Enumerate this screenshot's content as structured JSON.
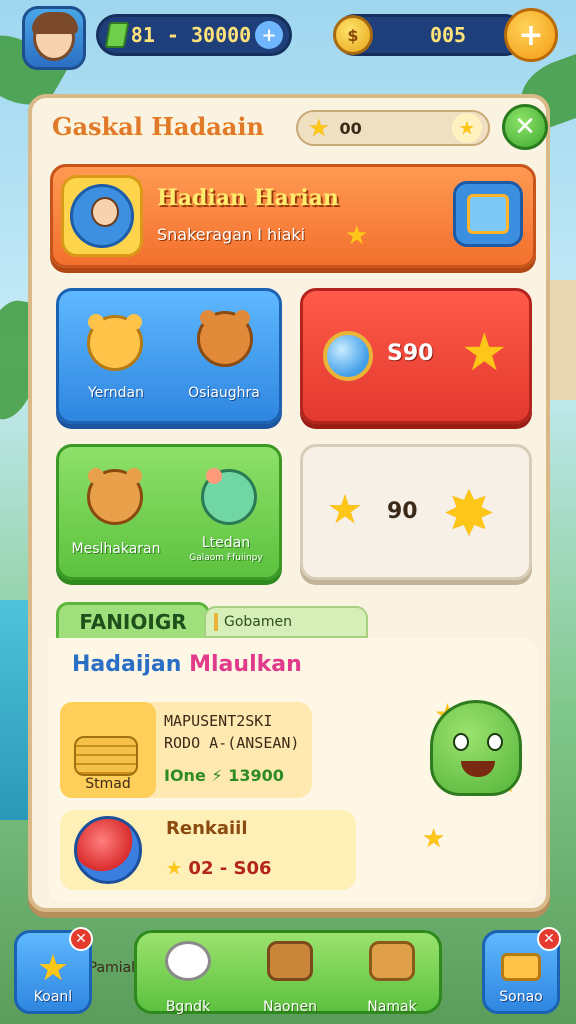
{
  "topbar": {
    "coins_value": "81 - 30000",
    "coins_plus": "+",
    "gems_value": "005",
    "gem_coin_glyph": "$",
    "add_button": "+"
  },
  "panel": {
    "title": "Gaskal Hadaain",
    "star_count": "00",
    "close_glyph": "✕",
    "daily": {
      "title": "Hadian Harian",
      "subtitle": "Snakeragan I hiaki"
    },
    "cards": {
      "blue": {
        "pet1_label": "Yerndan",
        "pet2_label": "Osiaughra"
      },
      "red": {
        "value": "S90"
      },
      "green": {
        "pet1_label": "Meslhakaran",
        "pet2_label": "Ltedan",
        "pet2_sub": "Galaom Ffuiinpy"
      },
      "white": {
        "value": "90"
      }
    },
    "section": {
      "tab_label": "FANIOIGR",
      "tab2_label": "Gobamen",
      "title_part1": "Hadaijan",
      "title_part2": "Mlaulkan",
      "row1": {
        "thumb_label": "Stmad",
        "line1": "MAPUSENT2SKI",
        "line2": "RODO A-(ANSEAN)",
        "price_prefix": "IOne",
        "price": "13900"
      },
      "row2": {
        "thumb_label": "Pamiak",
        "title": "Renkaiil",
        "price": "02 - S06"
      }
    }
  },
  "nav": {
    "left_label": "Koanl",
    "center_items": [
      "Bgndk",
      "Naonen",
      "Namak"
    ],
    "right_label": "Sonao",
    "badge_glyph": "✕"
  },
  "colors": {
    "accent_orange": "#f3702e",
    "accent_blue": "#2f86e0",
    "accent_green": "#5cc23e",
    "accent_red": "#e23a2e",
    "gold": "#ffc61a"
  }
}
